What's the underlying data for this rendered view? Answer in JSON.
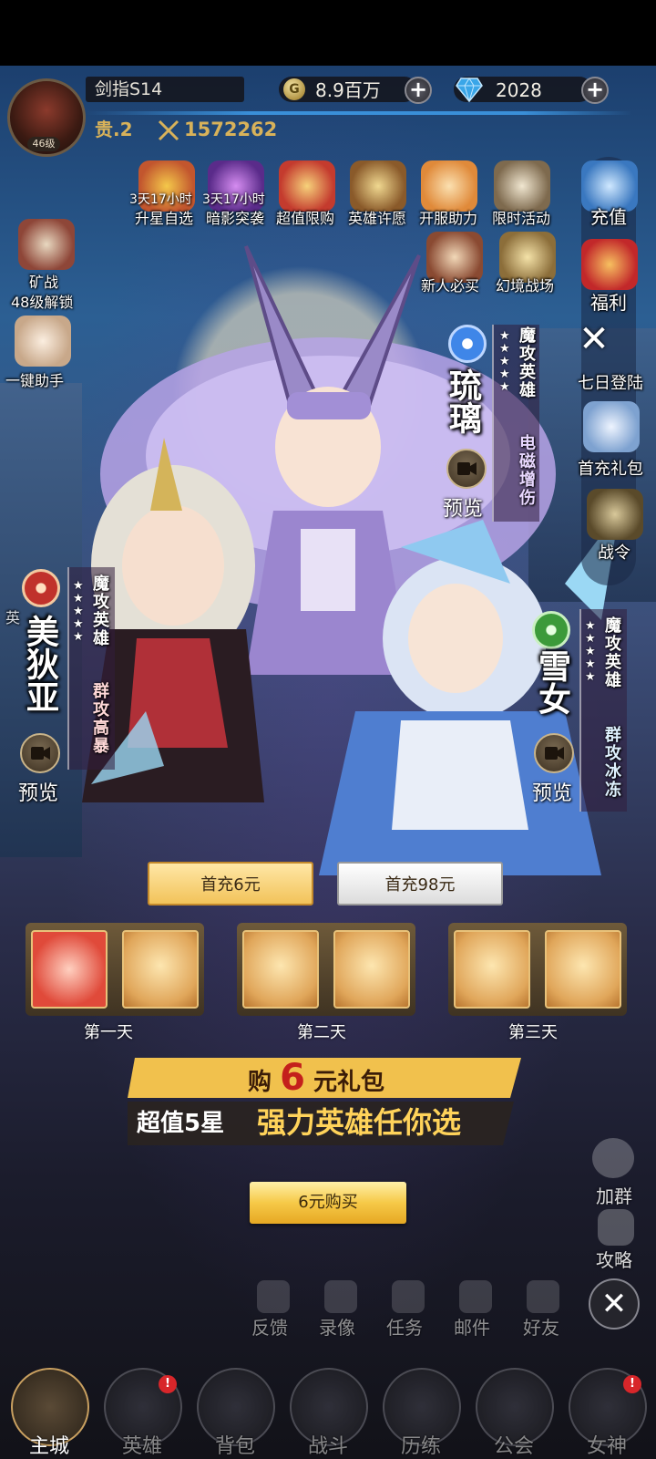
{
  "player": {
    "name": "剑指S14",
    "level": "46级",
    "vip": "贵.2",
    "power": "1572262",
    "gold": "8.9百万",
    "gold_symbol": "G",
    "diamonds": "2028"
  },
  "activities": [
    {
      "label": "升星自选",
      "timer": "3天17小时"
    },
    {
      "label": "暗影突袭",
      "timer": "3天17小时"
    },
    {
      "label": "超值限购"
    },
    {
      "label": "英雄许愿"
    },
    {
      "label": "开服助力"
    },
    {
      "label": "限时活动"
    },
    {
      "label": "新人必买"
    },
    {
      "label": "幻境战场"
    }
  ],
  "left_side": {
    "mine_label": "矿战",
    "mine_sub": "48级解锁",
    "helper_label": "一键助手",
    "hero_partial": "英"
  },
  "right_side": {
    "recharge": "充值",
    "welfare": "福利",
    "seven_day": "七日登陆",
    "first_gift": "首充礼包",
    "battle_pass": "战令",
    "join_group": "加群",
    "guide": "攻略"
  },
  "heroes": [
    {
      "name": "美狄亚",
      "role": "魔攻英雄",
      "trait": "群攻高暴",
      "stars": 5,
      "element_color": "#c0322b"
    },
    {
      "name": "琉璃",
      "role": "魔攻英雄",
      "trait": "电磁增伤",
      "stars": 5,
      "element_color": "#2c6fd1"
    },
    {
      "name": "雪女",
      "role": "魔攻英雄",
      "trait": "群攻冰冻",
      "stars": 5,
      "element_color": "#3c9a3a"
    }
  ],
  "preview_label": "预览",
  "offer": {
    "tabs": [
      "首充6元",
      "首充98元"
    ],
    "days": [
      "第一天",
      "第二天",
      "第三天"
    ],
    "banner_line1_pre": "购",
    "banner_line1_num": "6",
    "banner_line1_post": "元礼包",
    "banner_line2_a": "超值5星",
    "banner_line2_b": "强力英雄任你选",
    "buy_button": "6元购买"
  },
  "quick_actions": [
    "反馈",
    "录像",
    "任务",
    "邮件",
    "好友"
  ],
  "nav": [
    "主城",
    "英雄",
    "背包",
    "战斗",
    "历练",
    "公会",
    "女神"
  ],
  "nav_badge": "!"
}
